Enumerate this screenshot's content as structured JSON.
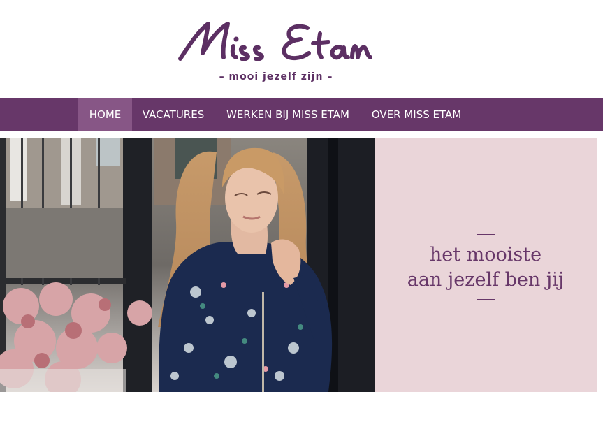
{
  "logo": {
    "text": "Miss Etam",
    "tagline": "– mooi jezelf zijn –"
  },
  "nav": {
    "items": [
      {
        "label": "HOME",
        "active": true
      },
      {
        "label": "VACATURES",
        "active": false
      },
      {
        "label": "WERKEN BIJ MISS ETAM",
        "active": false
      },
      {
        "label": "OVER MISS ETAM",
        "active": false
      }
    ]
  },
  "hero": {
    "slogan_line1": "het mooiste",
    "slogan_line2": "aan jezelf ben jij"
  },
  "colors": {
    "brand": "#673769",
    "nav_active": "#875686",
    "hero_panel": "#ead5d9"
  }
}
